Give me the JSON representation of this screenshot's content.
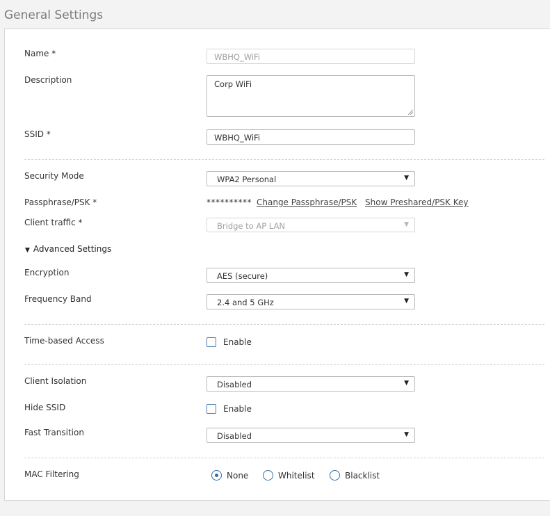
{
  "page_title": "General Settings",
  "fields": {
    "name": {
      "label": "Name *",
      "value": "WBHQ_WiFi"
    },
    "description": {
      "label": "Description",
      "value": "Corp WiFi"
    },
    "ssid": {
      "label": "SSID *",
      "value": "WBHQ_WiFi"
    },
    "security_mode": {
      "label": "Security Mode",
      "value": "WPA2 Personal"
    },
    "passphrase": {
      "label": "Passphrase/PSK *",
      "masked": "**********",
      "change_link": "Change Passphrase/PSK",
      "show_link": "Show Preshared/PSK Key"
    },
    "client_traffic": {
      "label": "Client traffic *",
      "value": "Bridge to AP LAN"
    }
  },
  "advanced": {
    "toggle_label": "Advanced Settings",
    "encryption": {
      "label": "Encryption",
      "value": "AES (secure)"
    },
    "frequency_band": {
      "label": "Frequency Band",
      "value": "2.4 and 5 GHz"
    }
  },
  "time_based_access": {
    "label": "Time-based Access",
    "checkbox_label": "Enable",
    "checked": false
  },
  "client_isolation": {
    "label": "Client Isolation",
    "value": "Disabled"
  },
  "hide_ssid": {
    "label": "Hide SSID",
    "checkbox_label": "Enable",
    "checked": false
  },
  "fast_transition": {
    "label": "Fast Transition",
    "value": "Disabled"
  },
  "mac_filtering": {
    "label": "MAC Filtering",
    "options": [
      "None",
      "Whitelist",
      "Blacklist"
    ],
    "selected": "None"
  },
  "icons": {
    "dropdown": "chevron-down-icon",
    "expand": "triangle-down-icon"
  },
  "colors": {
    "accent": "#2f6ea8",
    "checkbox_border": "#4a7fb0"
  }
}
